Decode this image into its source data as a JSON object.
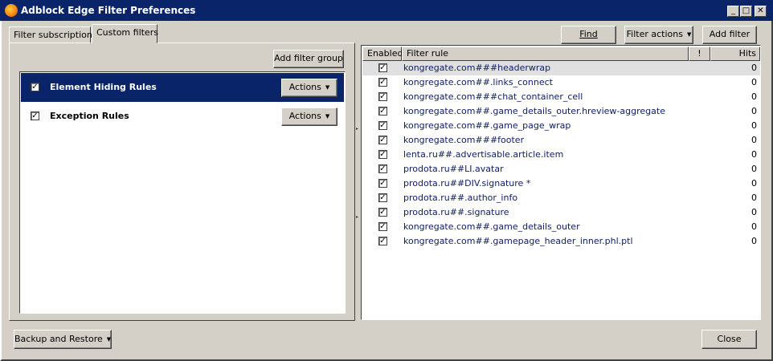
{
  "window": {
    "title": "Adblock Edge Filter Preferences",
    "buttons": {
      "minimize": "_",
      "maximize": "□",
      "close": "✕"
    }
  },
  "tabs": [
    {
      "label": "Filter subscriptions",
      "active": false
    },
    {
      "label": "Custom filters",
      "active": true
    }
  ],
  "toolbar": {
    "find_label": "Find",
    "filter_actions_label": "Filter actions",
    "add_filter_label": "Add filter"
  },
  "groups_panel": {
    "add_group_label": "Add filter group",
    "groups": [
      {
        "name": "Element Hiding Rules",
        "enabled": true,
        "selected": true,
        "actions_label": "Actions"
      },
      {
        "name": "Exception Rules",
        "enabled": true,
        "selected": false,
        "actions_label": "Actions"
      }
    ]
  },
  "rules_table": {
    "columns": {
      "enabled": "Enabled",
      "rule": "Filter rule",
      "priority": "!",
      "hits": "Hits"
    },
    "rows": [
      {
        "rule": "kongregate.com###headerwrap",
        "enabled": true,
        "hits": "0",
        "selected": true
      },
      {
        "rule": "kongregate.com##.links_connect",
        "enabled": true,
        "hits": "0"
      },
      {
        "rule": "kongregate.com###chat_container_cell",
        "enabled": true,
        "hits": "0"
      },
      {
        "rule": "kongregate.com##.game_details_outer.hreview-aggregate",
        "enabled": true,
        "hits": "0"
      },
      {
        "rule": "kongregate.com##.game_page_wrap",
        "enabled": true,
        "hits": "0"
      },
      {
        "rule": "kongregate.com###footer",
        "enabled": true,
        "hits": "0"
      },
      {
        "rule": "lenta.ru##.advertisable.article.item",
        "enabled": true,
        "hits": "0"
      },
      {
        "rule": "prodota.ru##LI.avatar",
        "enabled": true,
        "hits": "0"
      },
      {
        "rule": "prodota.ru##DIV.signature *",
        "enabled": true,
        "hits": "0"
      },
      {
        "rule": "prodota.ru##.author_info",
        "enabled": true,
        "hits": "0"
      },
      {
        "rule": "prodota.ru##.signature",
        "enabled": true,
        "hits": "0"
      },
      {
        "rule": "kongregate.com##.game_details_outer",
        "enabled": true,
        "hits": "0"
      },
      {
        "rule": "kongregate.com##.gamepage_header_inner.phl.ptl",
        "enabled": true,
        "hits": "0"
      }
    ]
  },
  "footer": {
    "backup_label": "Backup and Restore",
    "close_label": "Close"
  },
  "colors": {
    "titlebar": "#0a246a",
    "selection": "#0a246a",
    "face": "#d4d0c8",
    "rule_text": "#10206a"
  }
}
